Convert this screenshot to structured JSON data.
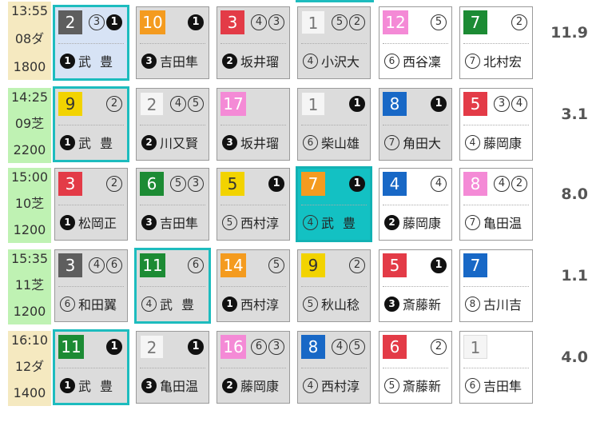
{
  "races": [
    {
      "time": "13:55",
      "course": "08ダ",
      "distance": "1800",
      "odds": "11.9",
      "surface": "dirt",
      "horses": [
        {
          "num": "2",
          "color": "#5e5e5e",
          "marks": [
            "③",
            "❶"
          ],
          "jockey_mark": "❶",
          "jockey": "武豊",
          "state": "mark"
        },
        {
          "num": "10",
          "color": "#f49b1f",
          "marks": [
            "❶"
          ],
          "jockey_mark": "❸",
          "jockey": "吉田隼",
          "state": "gray"
        },
        {
          "num": "3",
          "color": "#e33b47",
          "marks": [
            "④",
            "③"
          ],
          "jockey_mark": "❷",
          "jockey": "坂井瑠",
          "state": "gray"
        },
        {
          "num": "1",
          "color": "#f5f5f5",
          "marks": [
            "⑤",
            "②"
          ],
          "jockey_mark": "④",
          "jockey": "小沢大",
          "state": "gray"
        },
        {
          "num": "12",
          "color": "#f48ad6",
          "marks": [
            "⑤"
          ],
          "jockey_mark": "⑥",
          "jockey": "西谷凜",
          "state": "white"
        },
        {
          "num": "7",
          "color": "#1c8b34",
          "marks": [
            "②"
          ],
          "jockey_mark": "⑦",
          "jockey": "北村宏",
          "state": "white"
        }
      ]
    },
    {
      "time": "14:25",
      "course": "09芝",
      "distance": "2200",
      "odds": "3.1",
      "surface": "turf",
      "horses": [
        {
          "num": "9",
          "color": "#f2d300",
          "marks": [
            "②"
          ],
          "jockey_mark": "❶",
          "jockey": "武豊",
          "state": "sel"
        },
        {
          "num": "2",
          "color": "#f5f5f5",
          "marks": [
            "④",
            "⑤"
          ],
          "jockey_mark": "❷",
          "jockey": "川又賢",
          "state": "gray"
        },
        {
          "num": "17",
          "color": "#f48ad6",
          "marks": [],
          "jockey_mark": "❸",
          "jockey": "坂井瑠",
          "state": "gray"
        },
        {
          "num": "1",
          "color": "#f5f5f5",
          "marks": [
            "❶"
          ],
          "jockey_mark": "⑥",
          "jockey": "柴山雄",
          "state": "gray"
        },
        {
          "num": "8",
          "color": "#1868c6",
          "marks": [
            "❶"
          ],
          "jockey_mark": "⑦",
          "jockey": "角田大",
          "state": "gray"
        },
        {
          "num": "5",
          "color": "#e33b47",
          "marks": [
            "③",
            "④"
          ],
          "jockey_mark": "④",
          "jockey": "藤岡康",
          "state": "white"
        }
      ]
    },
    {
      "time": "15:00",
      "course": "10芝",
      "distance": "1200",
      "odds": "8.0",
      "surface": "turf",
      "horses": [
        {
          "num": "3",
          "color": "#e33b47",
          "marks": [
            "②"
          ],
          "jockey_mark": "❶",
          "jockey": "松岡正",
          "state": "gray"
        },
        {
          "num": "6",
          "color": "#1c8b34",
          "marks": [
            "⑤",
            "③"
          ],
          "jockey_mark": "❸",
          "jockey": "吉田隼",
          "state": "gray"
        },
        {
          "num": "5",
          "color": "#f2d300",
          "marks": [
            "❶"
          ],
          "jockey_mark": "⑤",
          "jockey": "西村淳",
          "state": "gray"
        },
        {
          "num": "7",
          "color": "#f49b1f",
          "marks": [
            "❶"
          ],
          "jockey_mark": "④",
          "jockey": "武豊",
          "state": "fill"
        },
        {
          "num": "4",
          "color": "#1868c6",
          "marks": [
            "④"
          ],
          "jockey_mark": "❷",
          "jockey": "藤岡康",
          "state": "white"
        },
        {
          "num": "8",
          "color": "#f48ad6",
          "marks": [
            "④",
            "②"
          ],
          "jockey_mark": "⑦",
          "jockey": "亀田温",
          "state": "white"
        }
      ]
    },
    {
      "time": "15:35",
      "course": "11芝",
      "distance": "1200",
      "odds": "1.1",
      "surface": "turf",
      "horses": [
        {
          "num": "3",
          "color": "#5e5e5e",
          "marks": [
            "④",
            "⑥"
          ],
          "jockey_mark": "⑥",
          "jockey": "和田翼",
          "state": "gray"
        },
        {
          "num": "11",
          "color": "#1c8b34",
          "marks": [
            "⑥"
          ],
          "jockey_mark": "④",
          "jockey": "武豊",
          "state": "sel"
        },
        {
          "num": "14",
          "color": "#f49b1f",
          "marks": [
            "⑤"
          ],
          "jockey_mark": "❶",
          "jockey": "西村淳",
          "state": "gray"
        },
        {
          "num": "9",
          "color": "#f2d300",
          "marks": [
            "②"
          ],
          "jockey_mark": "⑤",
          "jockey": "秋山稔",
          "state": "gray"
        },
        {
          "num": "5",
          "color": "#e33b47",
          "marks": [
            "❶"
          ],
          "jockey_mark": "❸",
          "jockey": "斎藤新",
          "state": "white"
        },
        {
          "num": "7",
          "color": "#1868c6",
          "marks": [],
          "jockey_mark": "⑧",
          "jockey": "古川吉",
          "state": "white"
        }
      ]
    },
    {
      "time": "16:10",
      "course": "12ダ",
      "distance": "1400",
      "odds": "4.0",
      "surface": "dirt",
      "horses": [
        {
          "num": "11",
          "color": "#1c8b34",
          "marks": [
            "❶"
          ],
          "jockey_mark": "❶",
          "jockey": "武豊",
          "state": "sel"
        },
        {
          "num": "2",
          "color": "#f5f5f5",
          "marks": [
            "❶"
          ],
          "jockey_mark": "❸",
          "jockey": "亀田温",
          "state": "gray"
        },
        {
          "num": "16",
          "color": "#f48ad6",
          "marks": [
            "⑥",
            "③"
          ],
          "jockey_mark": "❷",
          "jockey": "藤岡康",
          "state": "gray"
        },
        {
          "num": "8",
          "color": "#1868c6",
          "marks": [
            "④",
            "⑤"
          ],
          "jockey_mark": "④",
          "jockey": "西村淳",
          "state": "gray"
        },
        {
          "num": "6",
          "color": "#e33b47",
          "marks": [
            "②"
          ],
          "jockey_mark": "⑤",
          "jockey": "斎藤新",
          "state": "white"
        },
        {
          "num": "1",
          "color": "#f5f5f5",
          "marks": [],
          "jockey_mark": "⑥",
          "jockey": "吉田隼",
          "state": "white"
        }
      ]
    }
  ]
}
